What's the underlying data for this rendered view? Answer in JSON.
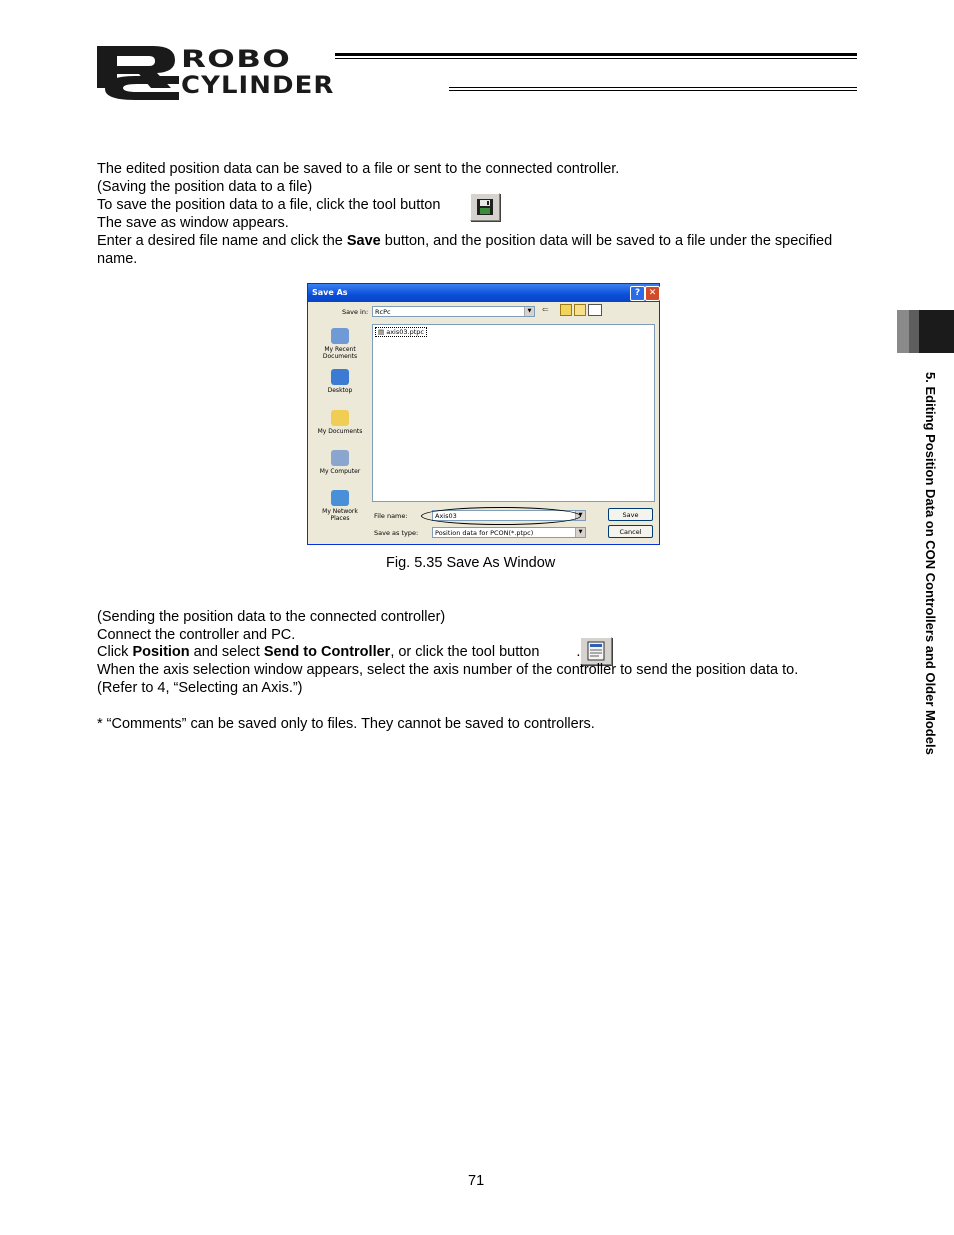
{
  "header": {
    "logo_word1": "ROBO",
    "logo_word2": "CYLINDER"
  },
  "side_tab": {
    "label": "5. Editing Position Data on CON Controllers and Older Models"
  },
  "body": {
    "p1": "The edited position data can be saved to a file or sent to the connected controller.",
    "p2": "(Saving the position data to a file)",
    "p3a": "To save the position data to a file, click the tool button",
    "p3b": ".",
    "p4": "The save as window appears.",
    "p5a": "Enter a desired file name and click the ",
    "p5b": "Save",
    "p5c": " button, and the position data will be saved to a file under the specified name.",
    "caption": "Fig. 5.35 Save As Window",
    "p6": "(Sending the position data to the connected controller)",
    "p7": "Connect the controller and PC.",
    "p8a": "Click ",
    "p8b": "Position",
    "p8c": " and select ",
    "p8d": "Send to Controller",
    "p8e": ", or click the tool button",
    "p8f": ".",
    "p9": "When the axis selection window appears, select the axis number of the controller to send the position data to.",
    "p10": "(Refer to 4, “Selecting an Axis.”)",
    "note": "*  “Comments” can be saved only to files. They cannot be saved to controllers.",
    "page_number": "71"
  },
  "dialog": {
    "title": "Save As",
    "help": "?",
    "close": "✕",
    "save_in_label": "Save in:",
    "save_in_value": "RcPc",
    "file_item": "axis03.ptpc",
    "places": [
      "My Recent Documents",
      "Desktop",
      "My Documents",
      "My Computer",
      "My Network Places"
    ],
    "file_name_label": "File name:",
    "file_name_value": "Axis03",
    "save_type_label": "Save as type:",
    "save_type_value": "Position data for PCON(*.ptpc)",
    "save_button": "Save",
    "cancel_button": "Cancel"
  },
  "colors": {
    "title_bar": "#0b4fd8",
    "dialog_bg": "#ece9d8",
    "side_tab_dark": "#1b1b1b"
  }
}
